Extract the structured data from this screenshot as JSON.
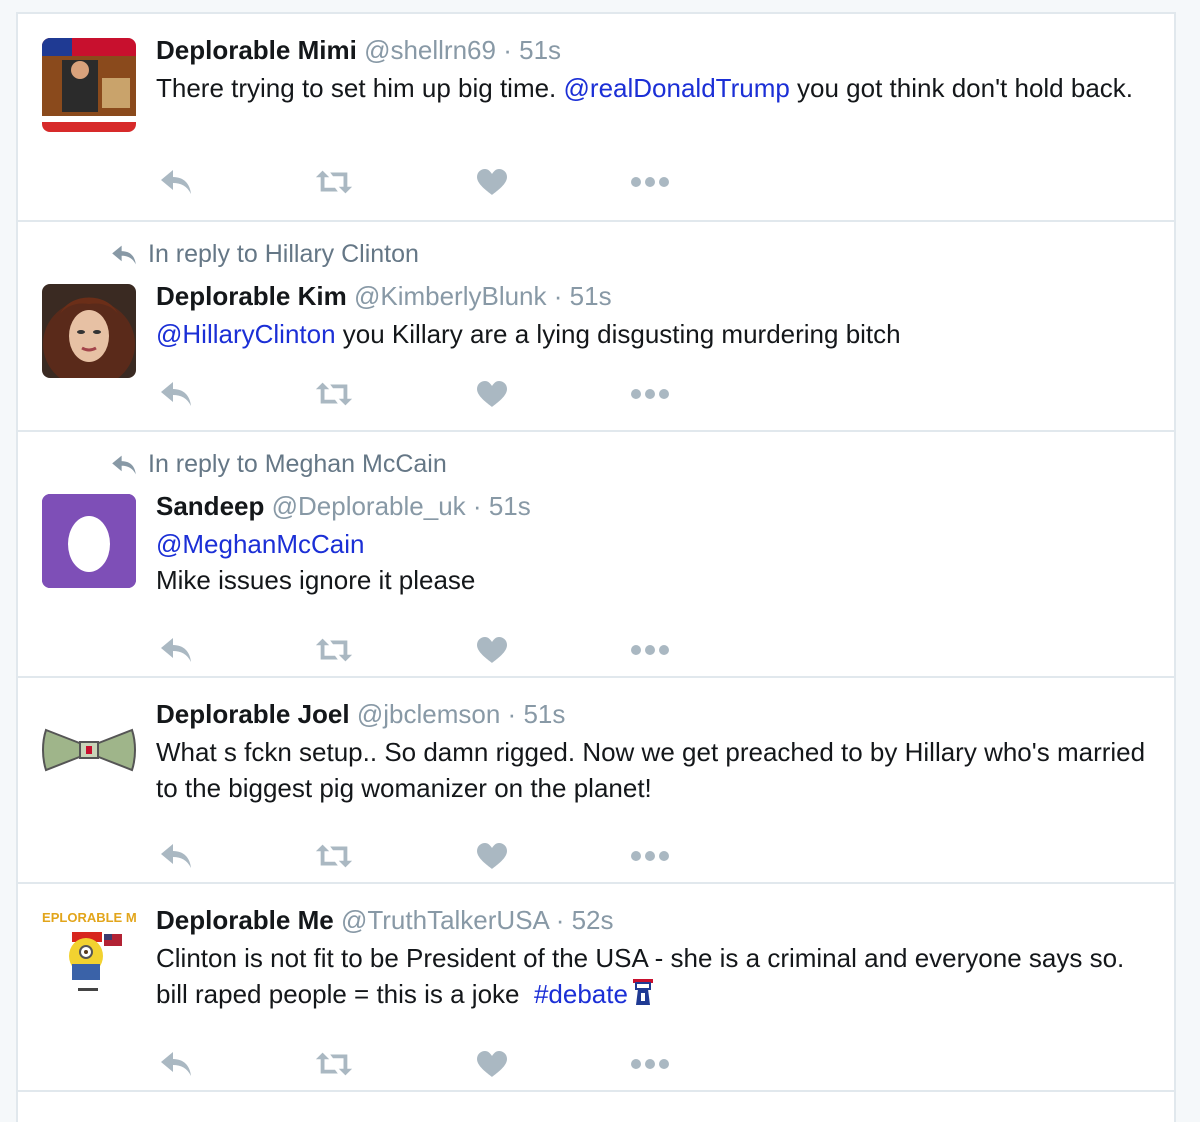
{
  "colors": {
    "link": "#1b2fd6",
    "muted": "#8899a6",
    "action_icon": "#aab8c2",
    "border": "#e1e8ed"
  },
  "tweets": [
    {
      "name": "Deplorable Mimi",
      "handle": "@shellrn69",
      "sep": "·",
      "time": "51s",
      "avatar": "american-flag-trump-banner",
      "text_parts": [
        "There trying to set him up big time. ",
        "@realDonaldTrump",
        " you got think don't hold back."
      ]
    },
    {
      "context": "In reply to Hillary Clinton",
      "name": "Deplorable Kim",
      "handle": "@KimberlyBlunk",
      "sep": "·",
      "time": "51s",
      "avatar": "woman-portrait",
      "text_parts": [
        "@HillaryClinton",
        " you Killary are a lying disgusting murdering bitch"
      ]
    },
    {
      "context": "In reply to Meghan McCain",
      "name": "Sandeep",
      "handle": "@Deplorable_uk",
      "sep": "·",
      "time": "51s",
      "avatar": "default-egg",
      "text_parts": [
        "@MeghanMcCain",
        "Mike issues ignore it please"
      ]
    },
    {
      "name": "Deplorable Joel",
      "handle": "@jbclemson",
      "sep": "·",
      "time": "51s",
      "avatar": "bow-tie",
      "text_parts": [
        "What s fckn setup.. So damn rigged. Now we get preached to by Hillary who's married to the biggest pig womanizer on the planet!"
      ]
    },
    {
      "name": "Deplorable Me",
      "handle": "@TruthTalkerUSA",
      "sep": "·",
      "time": "52s",
      "avatar": "deplorable-me-minion",
      "avatar_text": "DEPLORABLE ME",
      "text_parts": [
        "Clinton is not fit to be President of the USA - she is a criminal and everyone says so.  bill raped people = this is a joke  ",
        "#debate",
        "podium-emoji"
      ]
    }
  ]
}
